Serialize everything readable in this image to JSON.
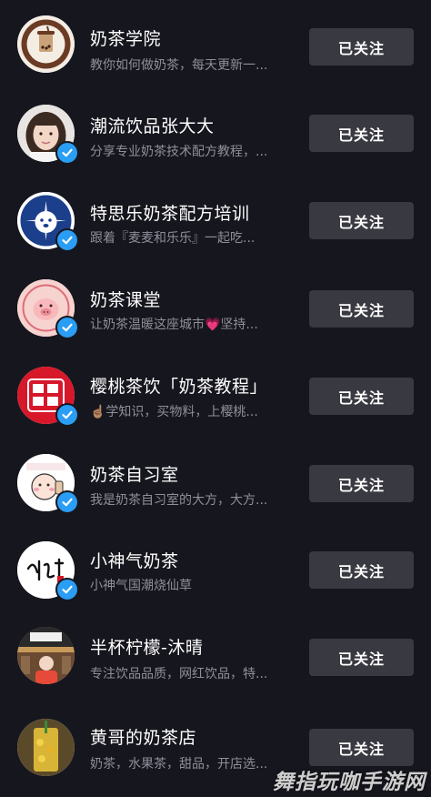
{
  "accounts": [
    {
      "name": "奶茶学院",
      "bio": "教你如何做奶茶，每天更新一...",
      "button": "已关注",
      "verified": false,
      "avatar": "milk-tea-college-logo"
    },
    {
      "name": "潮流饮品张大大",
      "bio": "分享专业奶茶技术配方教程，...",
      "button": "已关注",
      "verified": true,
      "avatar": "portrait-photo"
    },
    {
      "name": "特思乐奶茶配方培训",
      "bio": "跟着『麦麦和乐乐』一起吃...",
      "button": "已关注",
      "verified": true,
      "avatar": "cartoon-bear-logo"
    },
    {
      "name": "奶茶课堂",
      "bio": "让奶茶温暖这座城市💗坚持...",
      "button": "已关注",
      "verified": true,
      "avatar": "come-on-pig-logo"
    },
    {
      "name": "樱桃茶饮「奶茶教程」",
      "bio": "☝🏽学知识，买物料，上樱桃...",
      "button": "已关注",
      "verified": true,
      "avatar": "cherry-tea-logo"
    },
    {
      "name": "奶茶自习室",
      "bio": "我是奶茶自习室的大方，大方...",
      "button": "已关注",
      "verified": true,
      "avatar": "study-room-cartoon"
    },
    {
      "name": "小神气奶茶",
      "bio": "小神气国潮烧仙草",
      "button": "已关注",
      "verified": true,
      "avatar": "calligraphy-logo"
    },
    {
      "name": "半杯柠檬-沐晴",
      "bio": "专注饮品品质，网红饮品，特...",
      "button": "已关注",
      "verified": false,
      "avatar": "shop-photo"
    },
    {
      "name": "黄哥的奶茶店",
      "bio": "奶茶，水果茶，甜品，开店选...",
      "button": "已关注",
      "verified": false,
      "avatar": "drink-photo"
    }
  ],
  "watermark": "舞指玩咖手游网",
  "colors": {
    "background": "#16161e",
    "button": "#393941",
    "verified": "#2a9df4",
    "bio": "#8f8f9a"
  }
}
